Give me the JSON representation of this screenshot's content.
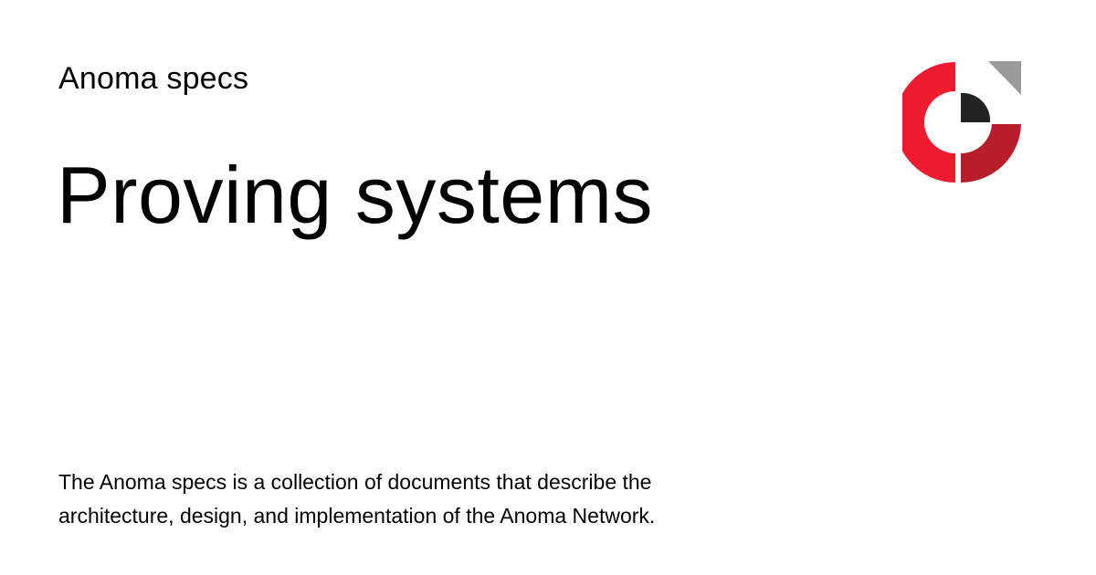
{
  "header": {
    "site_name": "Anoma specs"
  },
  "main": {
    "title": "Proving systems",
    "description": "The Anoma specs is a collection of documents that describe the architecture, design, and implementation of the Anoma Network."
  },
  "logo": {
    "icon": "anoma-logo-icon",
    "colors": {
      "red_primary": "#ee1c2e",
      "red_dark": "#b81d2a",
      "core": "#222222",
      "corner": "#9a9a9a"
    }
  }
}
